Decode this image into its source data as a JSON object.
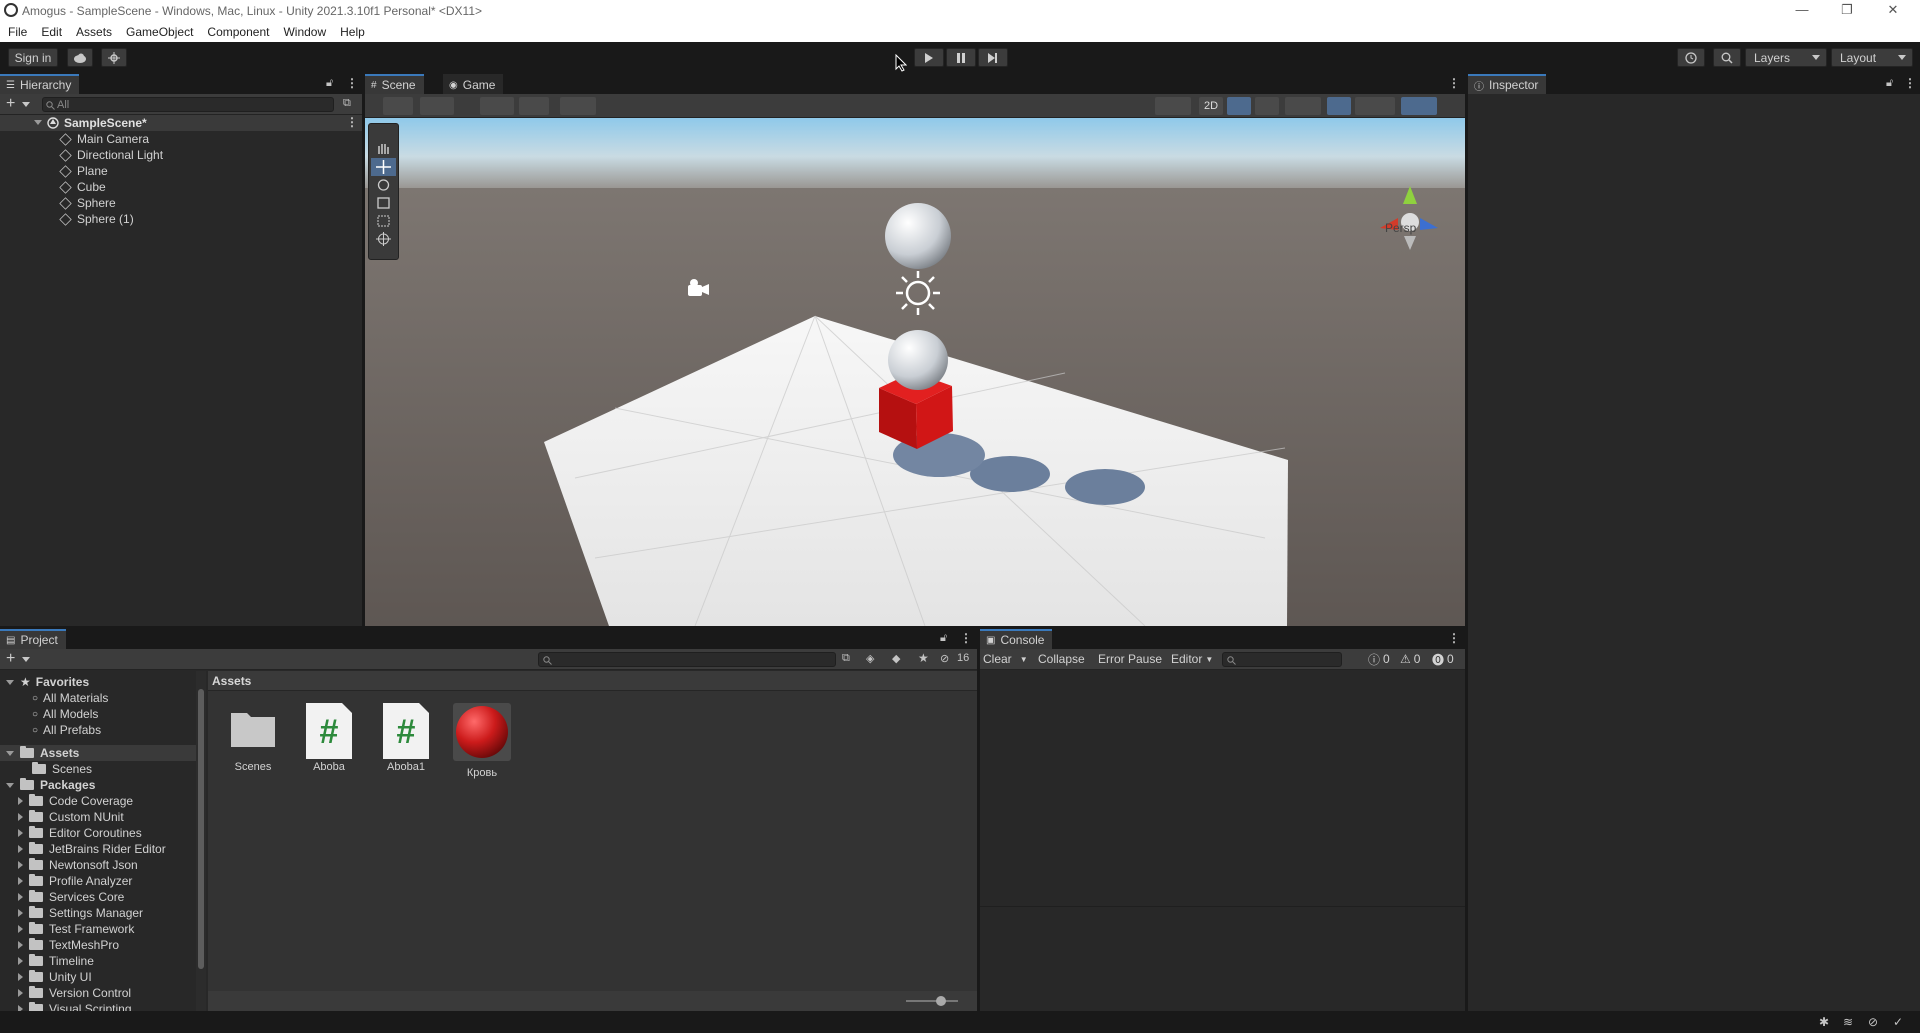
{
  "window": {
    "title": "Amogus - SampleScene - Windows, Mac, Linux - Unity 2021.3.10f1 Personal* <DX11>",
    "controls": {
      "minimize": "—",
      "maximize": "❐",
      "close": "✕"
    }
  },
  "menu": [
    "File",
    "Edit",
    "Assets",
    "GameObject",
    "Component",
    "Window",
    "Help"
  ],
  "toolbar": {
    "sign_in": "Sign in",
    "play_icon": "play-icon",
    "layers": "Layers",
    "layout": "Layout"
  },
  "hierarchy": {
    "tab": "Hierarchy",
    "search_placeholder": "All",
    "scene": "SampleScene*",
    "items": [
      "Main Camera",
      "Directional Light",
      "Plane",
      "Cube",
      "Sphere",
      "Sphere (1)"
    ]
  },
  "scene_view": {
    "tabs": [
      "Scene",
      "Game"
    ],
    "toggle_2d": "2D",
    "persp": "Persp",
    "gizmo": {
      "y": "y",
      "x": "x",
      "z": "z"
    }
  },
  "inspector": {
    "tab": "Inspector"
  },
  "project": {
    "tab": "Project",
    "favorites_label": "Favorites",
    "favorites": [
      "All Materials",
      "All Models",
      "All Prefabs"
    ],
    "assets_label": "Assets",
    "assets_children": [
      "Scenes"
    ],
    "packages_label": "Packages",
    "packages": [
      "Code Coverage",
      "Custom NUnit",
      "Editor Coroutines",
      "JetBrains Rider Editor",
      "Newtonsoft Json",
      "Profile Analyzer",
      "Services Core",
      "Settings Manager",
      "Test Framework",
      "TextMeshPro",
      "Timeline",
      "Unity UI",
      "Version Control",
      "Visual Scripting"
    ],
    "breadcrumb": "Assets",
    "hidden_count": "16",
    "grid_items": [
      {
        "name": "Scenes",
        "kind": "folder"
      },
      {
        "name": "Aboba",
        "kind": "script"
      },
      {
        "name": "Aboba1",
        "kind": "script"
      },
      {
        "name": "Кровь",
        "kind": "material",
        "color": "#cc1b1b"
      }
    ]
  },
  "console": {
    "tab": "Console",
    "clear": "Clear",
    "collapse": "Collapse",
    "error_pause": "Error Pause",
    "editor": "Editor",
    "log_count": "0",
    "warn_count": "0",
    "error_count": "0"
  }
}
